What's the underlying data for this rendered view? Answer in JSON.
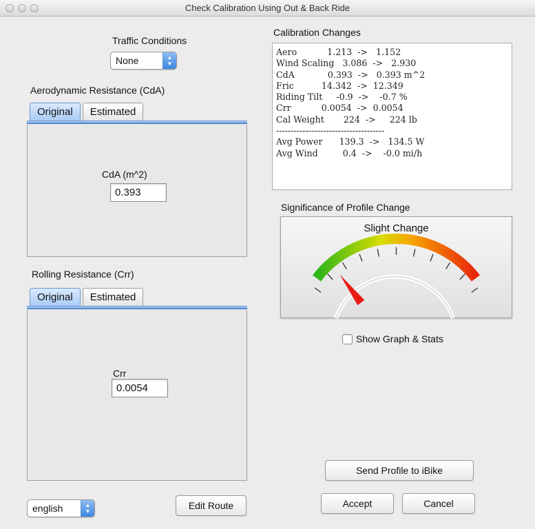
{
  "window": {
    "title": "Check Calibration Using Out & Back Ride"
  },
  "traffic": {
    "label": "Traffic Conditions",
    "value": "None"
  },
  "aero": {
    "label": "Aerodynamic Resistance (CdA)",
    "tab_original": "Original",
    "tab_estimated": "Estimated",
    "field_label": "CdA (m^2)",
    "value": "0.393"
  },
  "rolling": {
    "label": "Rolling Resistance (Crr)",
    "tab_original": "Original",
    "tab_estimated": "Estimated",
    "field_label": "Crr",
    "value": "0.0054"
  },
  "calibration": {
    "heading": "Calibration Changes",
    "rows": [
      "Aero           1.213  ->   1.152",
      "Wind Scaling   3.086  ->   2.930",
      "CdA            0.393  ->   0.393 m^2",
      "Fric          14.342  ->  12.349",
      "Riding Tilt     -0.9  ->    -0.7 %",
      "Crr           0.0054  ->  0.0054",
      "Cal Weight       224  ->     224 lb",
      "-------------------------------------",
      "Avg Power      139.3  ->   134.5 W",
      "Avg Wind         0.4  ->    -0.0 mi/h"
    ]
  },
  "significance": {
    "heading": "Significance of Profile Change",
    "gauge_label": "Slight Change",
    "level": 0.15,
    "colors": {
      "low": "#2bb51a",
      "mid": "#f0d400",
      "high": "#e8250c",
      "needle": "#e81c12"
    }
  },
  "show_graph": {
    "label": "Show Graph & Stats",
    "checked": false
  },
  "language": {
    "value": "english"
  },
  "buttons": {
    "edit_route": "Edit Route",
    "send_profile": "Send Profile to iBike",
    "accept": "Accept",
    "cancel": "Cancel"
  }
}
